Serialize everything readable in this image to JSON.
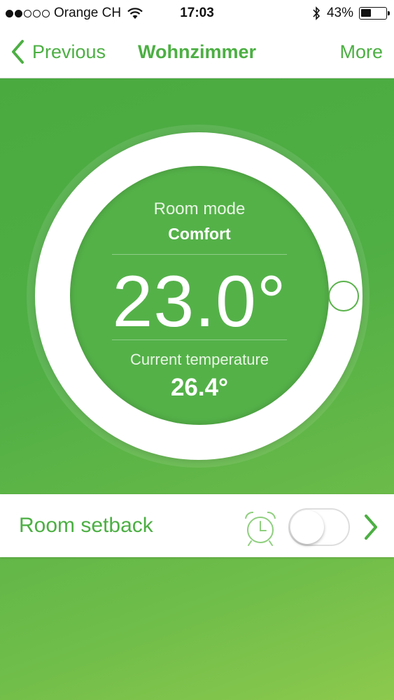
{
  "status_bar": {
    "carrier": "Orange CH",
    "time": "17:03",
    "battery_percent": "43%",
    "battery_level": 0.43,
    "signal_bars_filled": 2,
    "signal_bars_total": 5
  },
  "nav": {
    "back_label": "Previous",
    "title": "Wohnzimmer",
    "more_label": "More"
  },
  "thermostat": {
    "room_mode_label": "Room mode",
    "room_mode_value": "Comfort",
    "setpoint": "23.0°",
    "current_label": "Current temperature",
    "current_value": "26.4°"
  },
  "setback": {
    "label": "Room setback",
    "toggle_on": false
  },
  "colors": {
    "accent": "#4caf43",
    "background": "#59b24a",
    "white": "#ffffff"
  },
  "icons": {
    "back": "chevron-left-icon",
    "alarm": "alarm-clock-icon",
    "next": "chevron-right-icon",
    "wifi": "wifi-icon",
    "bluetooth": "bluetooth-icon",
    "battery": "battery-icon"
  }
}
